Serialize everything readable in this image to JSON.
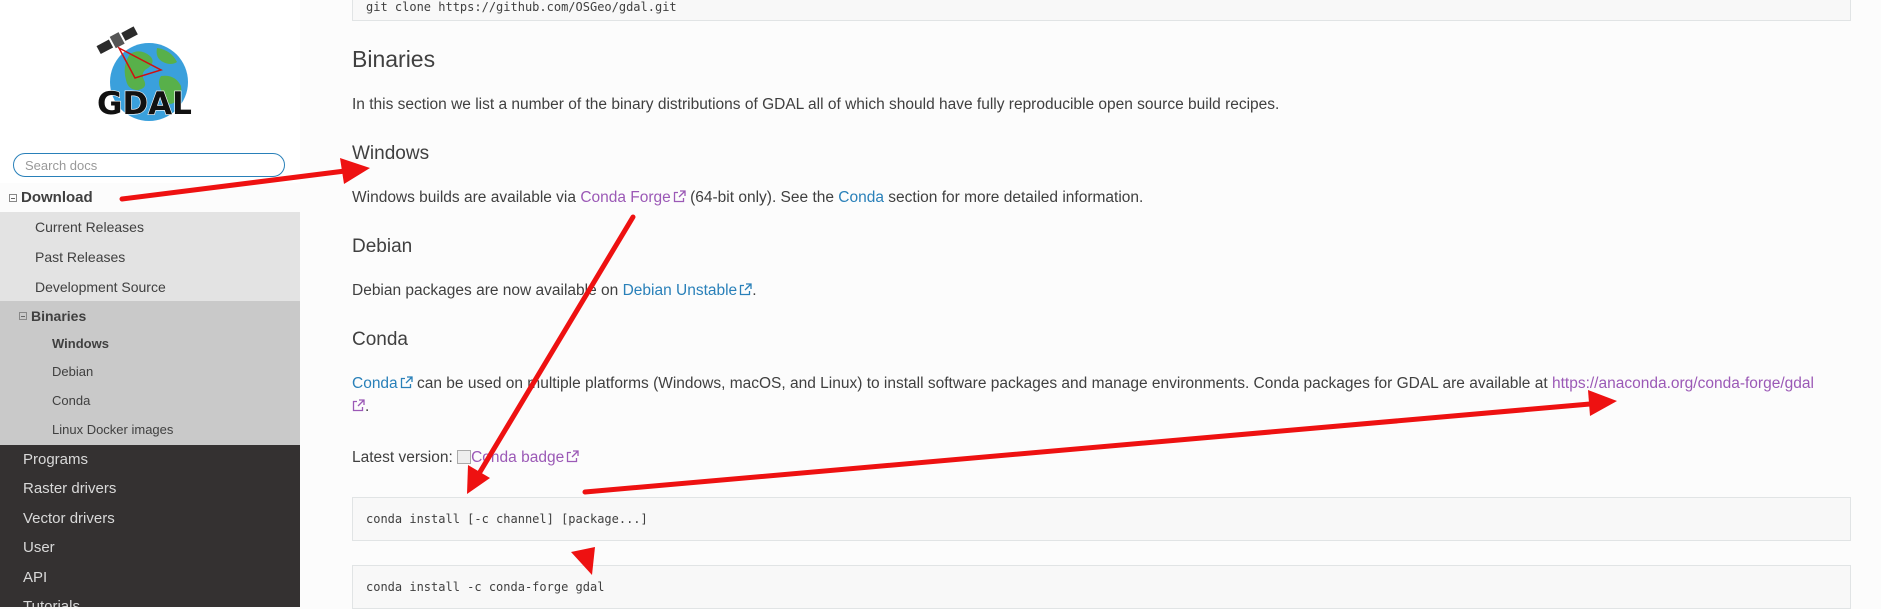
{
  "sidebar": {
    "logo_text": "GDAL",
    "search_placeholder": "Search docs",
    "current_section": "Download",
    "download_items": [
      "Current Releases",
      "Past Releases",
      "Development Source"
    ],
    "binaries_label": "Binaries",
    "binaries_items": [
      "Windows",
      "Debian",
      "Conda",
      "Linux Docker images"
    ],
    "top_items": [
      "Programs",
      "Raster drivers",
      "Vector drivers",
      "User",
      "API",
      "Tutorials"
    ]
  },
  "main": {
    "top_code": "git clone https://github.com/OSGeo/gdal.git",
    "binaries_heading": "Binaries",
    "binaries_intro": "In this section we list a number of the binary distributions of GDAL all of which should have fully reproducible open source build recipes.",
    "windows": {
      "heading": "Windows",
      "text_before": "Windows builds are available via ",
      "link_conda_forge": "Conda Forge",
      "text_middle": " (64-bit only). See the ",
      "link_conda": "Conda",
      "text_after": " section for more detailed information."
    },
    "debian": {
      "heading": "Debian",
      "text_before": "Debian packages are now available on ",
      "link": "Debian Unstable",
      "text_after": "."
    },
    "conda": {
      "heading": "Conda",
      "link_conda": "Conda",
      "text_middle": " can be used on multiple platforms (Windows, macOS, and Linux) to install software packages and manage environments. Conda packages for GDAL are available at ",
      "link_url": "https://anaconda.org/conda-forge/gdal",
      "text_after": ".",
      "latest_label": "Latest version: ",
      "badge_alt": "Conda badge",
      "code1": "conda install [-c channel] [package...]",
      "code2": "conda install -c conda-forge gdal"
    }
  },
  "colors": {
    "annotation_arrow": "#ee1111",
    "link": "#2980b9",
    "visited_link": "#9b59b6"
  }
}
